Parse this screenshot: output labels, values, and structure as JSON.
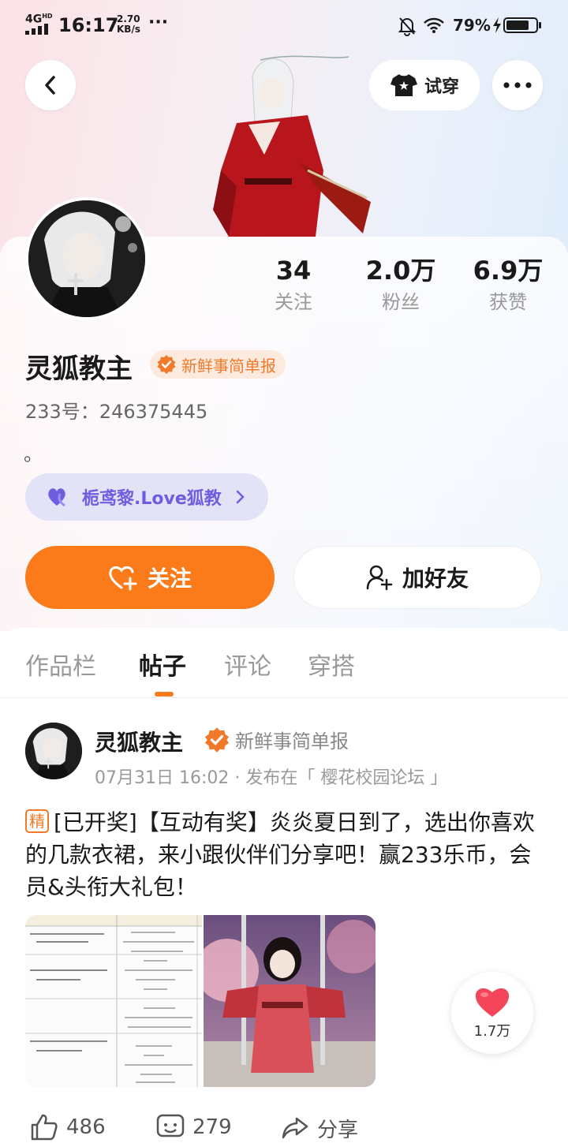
{
  "status_bar": {
    "network": "4G",
    "network_sup": "HD",
    "time": "16:17",
    "speed_value": "2.70",
    "speed_unit": "KB/s",
    "more": "···",
    "battery_text": "79%",
    "battery_level": 0.79
  },
  "header": {
    "try_on_label": "试穿",
    "more_icon": "more-dots-icon"
  },
  "profile": {
    "stats": [
      {
        "value": "34",
        "label": "关注"
      },
      {
        "value": "2.0万",
        "label": "粉丝"
      },
      {
        "value": "6.9万",
        "label": "获赞"
      }
    ],
    "name": "灵狐教主",
    "badge_label": "新鲜事简单报",
    "uid": "233号：246375445",
    "bio": "。",
    "guild_label": "栀鸢黎.Love狐教",
    "follow_label": "关注",
    "add_friend_label": "加好友"
  },
  "tabs": [
    {
      "label": "作品栏",
      "active": false
    },
    {
      "label": "帖子",
      "active": true
    },
    {
      "label": "评论",
      "active": false
    },
    {
      "label": "穿搭",
      "active": false
    }
  ],
  "post": {
    "author": "灵狐教主",
    "badge_label": "新鲜事简单报",
    "meta": "07月31日 16:02 · 发布在「 樱花校园论坛 」",
    "tag": "精",
    "text": "[已开奖]【互动有奖】炎炎夏日到了，选出你喜欢的几款衣裙，来小跟伙伴们分享吧！赢233乐币，会员&头衔大礼包！",
    "like_fab_count": "1.7万",
    "actions": [
      {
        "icon": "thumb-up-icon",
        "count": "486"
      },
      {
        "icon": "comment-icon",
        "count": "279"
      },
      {
        "icon": "share-icon",
        "count": "分享"
      }
    ]
  },
  "colors": {
    "accent": "#fb7a1a",
    "badge_orange": "#f07a2a",
    "guild_purple": "#6d5ee0",
    "heart_red": "#f5455a"
  }
}
